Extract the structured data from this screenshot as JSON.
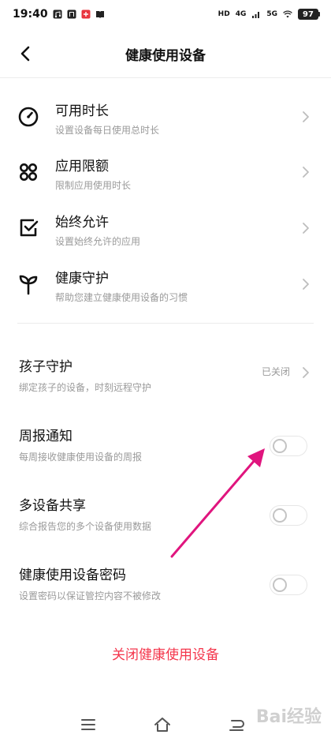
{
  "status_bar": {
    "time": "19:40",
    "network_1": "4G",
    "network_2": "5G",
    "hd_badge": "HD",
    "battery": "97",
    "icons": [
      "music-icon",
      "gallery-icon",
      "app-red-icon",
      "book-icon",
      "wifi-icon",
      "signal-icon"
    ]
  },
  "header": {
    "title": "健康使用设备",
    "back_icon": "chevron-left-icon"
  },
  "items": [
    {
      "title": "可用时长",
      "subtitle": "设置设备每日使用总时长",
      "icon": "timer-icon"
    },
    {
      "title": "应用限额",
      "subtitle": "限制应用使用时长",
      "icon": "apps-grid-icon"
    },
    {
      "title": "始终允许",
      "subtitle": "设置始终允许的应用",
      "icon": "checkbox-icon"
    },
    {
      "title": "健康守护",
      "subtitle": "帮助您建立健康使用设备的习惯",
      "icon": "sprout-icon"
    }
  ],
  "child_guard": {
    "title": "孩子守护",
    "subtitle": "绑定孩子的设备，时刻远程守护",
    "status": "已关闭"
  },
  "toggles": [
    {
      "title": "周报通知",
      "subtitle": "每周接收健康使用设备的周报",
      "enabled": false
    },
    {
      "title": "多设备共享",
      "subtitle": "综合报告您的多个设备使用数据",
      "enabled": false
    },
    {
      "title": "健康使用设备密码",
      "subtitle": "设置密码以保证管控内容不被修改",
      "enabled": false
    }
  ],
  "footer_action": {
    "label": "关闭健康使用设备",
    "color": "#f4364c"
  },
  "bottom_nav": [
    "menu-icon",
    "home-icon",
    "back-icon"
  ],
  "watermark": "Bai经验",
  "colors": {
    "annotation_arrow": "#e0157e",
    "secondary_text": "#9a9a9a"
  }
}
